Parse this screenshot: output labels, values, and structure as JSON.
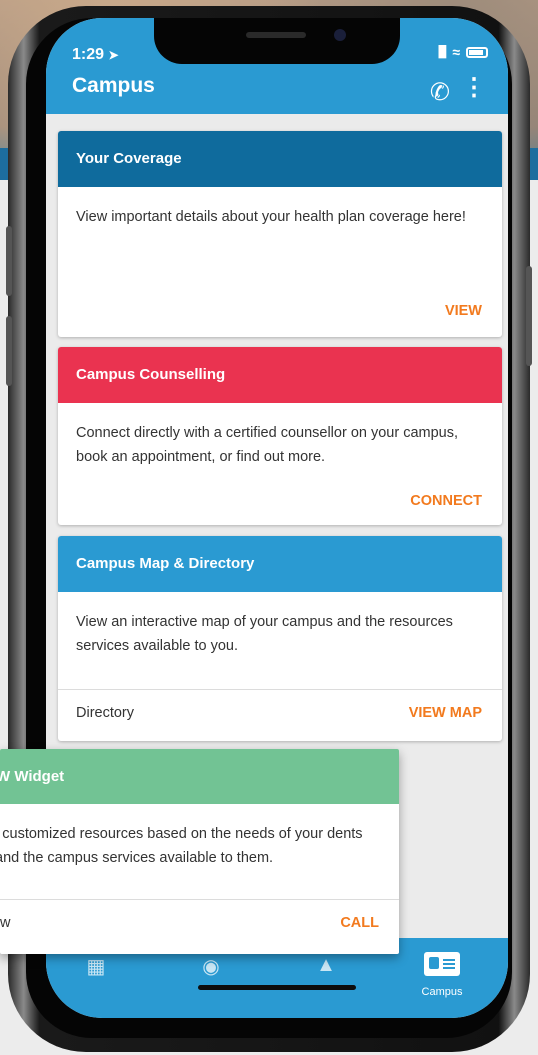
{
  "status": {
    "time": "1:29"
  },
  "app": {
    "title": "Campus"
  },
  "cards": [
    {
      "title": "Your Coverage",
      "body": "View important details about your health plan coverage here!",
      "action": "VIEW",
      "color": "#0f6b9d"
    },
    {
      "title": "Campus Counselling",
      "body": "Connect directly with a certified counsellor on your campus, book an appointment, or find out more.",
      "action": "CONNECT",
      "color": "#ea3350"
    },
    {
      "title": "Campus Map & Directory",
      "body": "View an interactive map of your campus and the resources services available to you.",
      "footer_left": "Directory",
      "footer_right": "VIEW MAP",
      "color": "#2a9ad2"
    }
  ],
  "widget": {
    "title": "W Widget",
    "body": "l customized resources based on the needs of your dents and the campus services available to them.",
    "footer_left": "w",
    "footer_right": "CALL",
    "color": "#72c394"
  },
  "tabs": [
    {
      "icon": "dashboard-icon",
      "label": ""
    },
    {
      "icon": "compass-icon",
      "label": ""
    },
    {
      "icon": "reading-icon",
      "label": ""
    },
    {
      "icon": "campus-id-card-icon",
      "label": "Campus"
    }
  ],
  "colors": {
    "accent": "#f27a1e",
    "header": "#2a9ad2"
  }
}
